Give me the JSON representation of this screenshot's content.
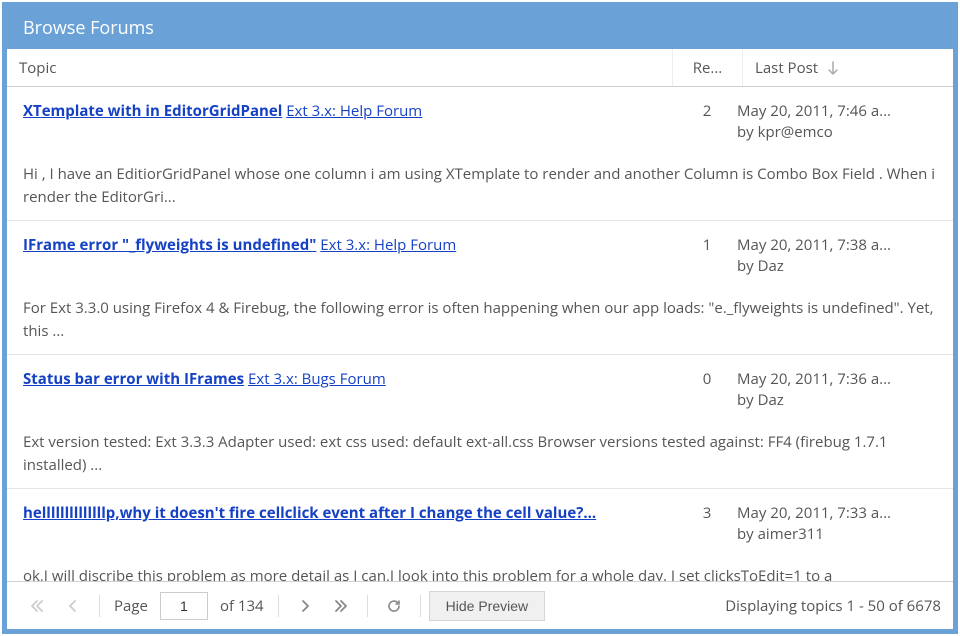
{
  "title": "Browse Forums",
  "columns": {
    "topic": "Topic",
    "replies": "Re...",
    "lastpost": "Last Post"
  },
  "rows": [
    {
      "title": "XTemplate with in EditorGridPanel",
      "forum": "Ext 3.x: Help Forum",
      "replies": "2",
      "date": "May 20, 2011, 7:46 a...",
      "author": "by kpr@emco",
      "excerpt": "Hi , I have an EditiorGridPanel whose one column i am using XTemplate to render and another Column is Combo Box Field . When i render the EditorGri..."
    },
    {
      "title": "IFrame error \"_flyweights is undefined\"",
      "forum": "Ext 3.x: Help Forum",
      "replies": "1",
      "date": "May 20, 2011, 7:38 a...",
      "author": "by Daz",
      "excerpt": "For Ext 3.3.0 using Firefox 4 & Firebug, the following error is often happening when our app loads: \"e._flyweights is undefined\". Yet, this ..."
    },
    {
      "title": "Status bar error with IFrames",
      "forum": "Ext 3.x: Bugs Forum",
      "replies": "0",
      "date": "May 20, 2011, 7:36 a...",
      "author": "by Daz",
      "excerpt": "Ext version tested: Ext 3.3.3 Adapter used: ext css used: default ext-all.css Browser versions tested against: FF4 (firebug 1.7.1 installed) ..."
    },
    {
      "title": "hellllllllllllllp,why it doesn't fire cellclick event after I change the cell value?...",
      "forum": "",
      "replies": "3",
      "date": "May 20, 2011, 7:33 a...",
      "author": "by aimer311",
      "excerpt": "ok,I will discribe this problem as more detail as I can,I look into this problem for a whole day. I set clicksToEdit=1 to a"
    }
  ],
  "toolbar": {
    "page_label": "Page",
    "page_value": "1",
    "of_label": "of 134",
    "hide_preview": "Hide Preview",
    "status": "Displaying topics 1 - 50 of 6678"
  }
}
